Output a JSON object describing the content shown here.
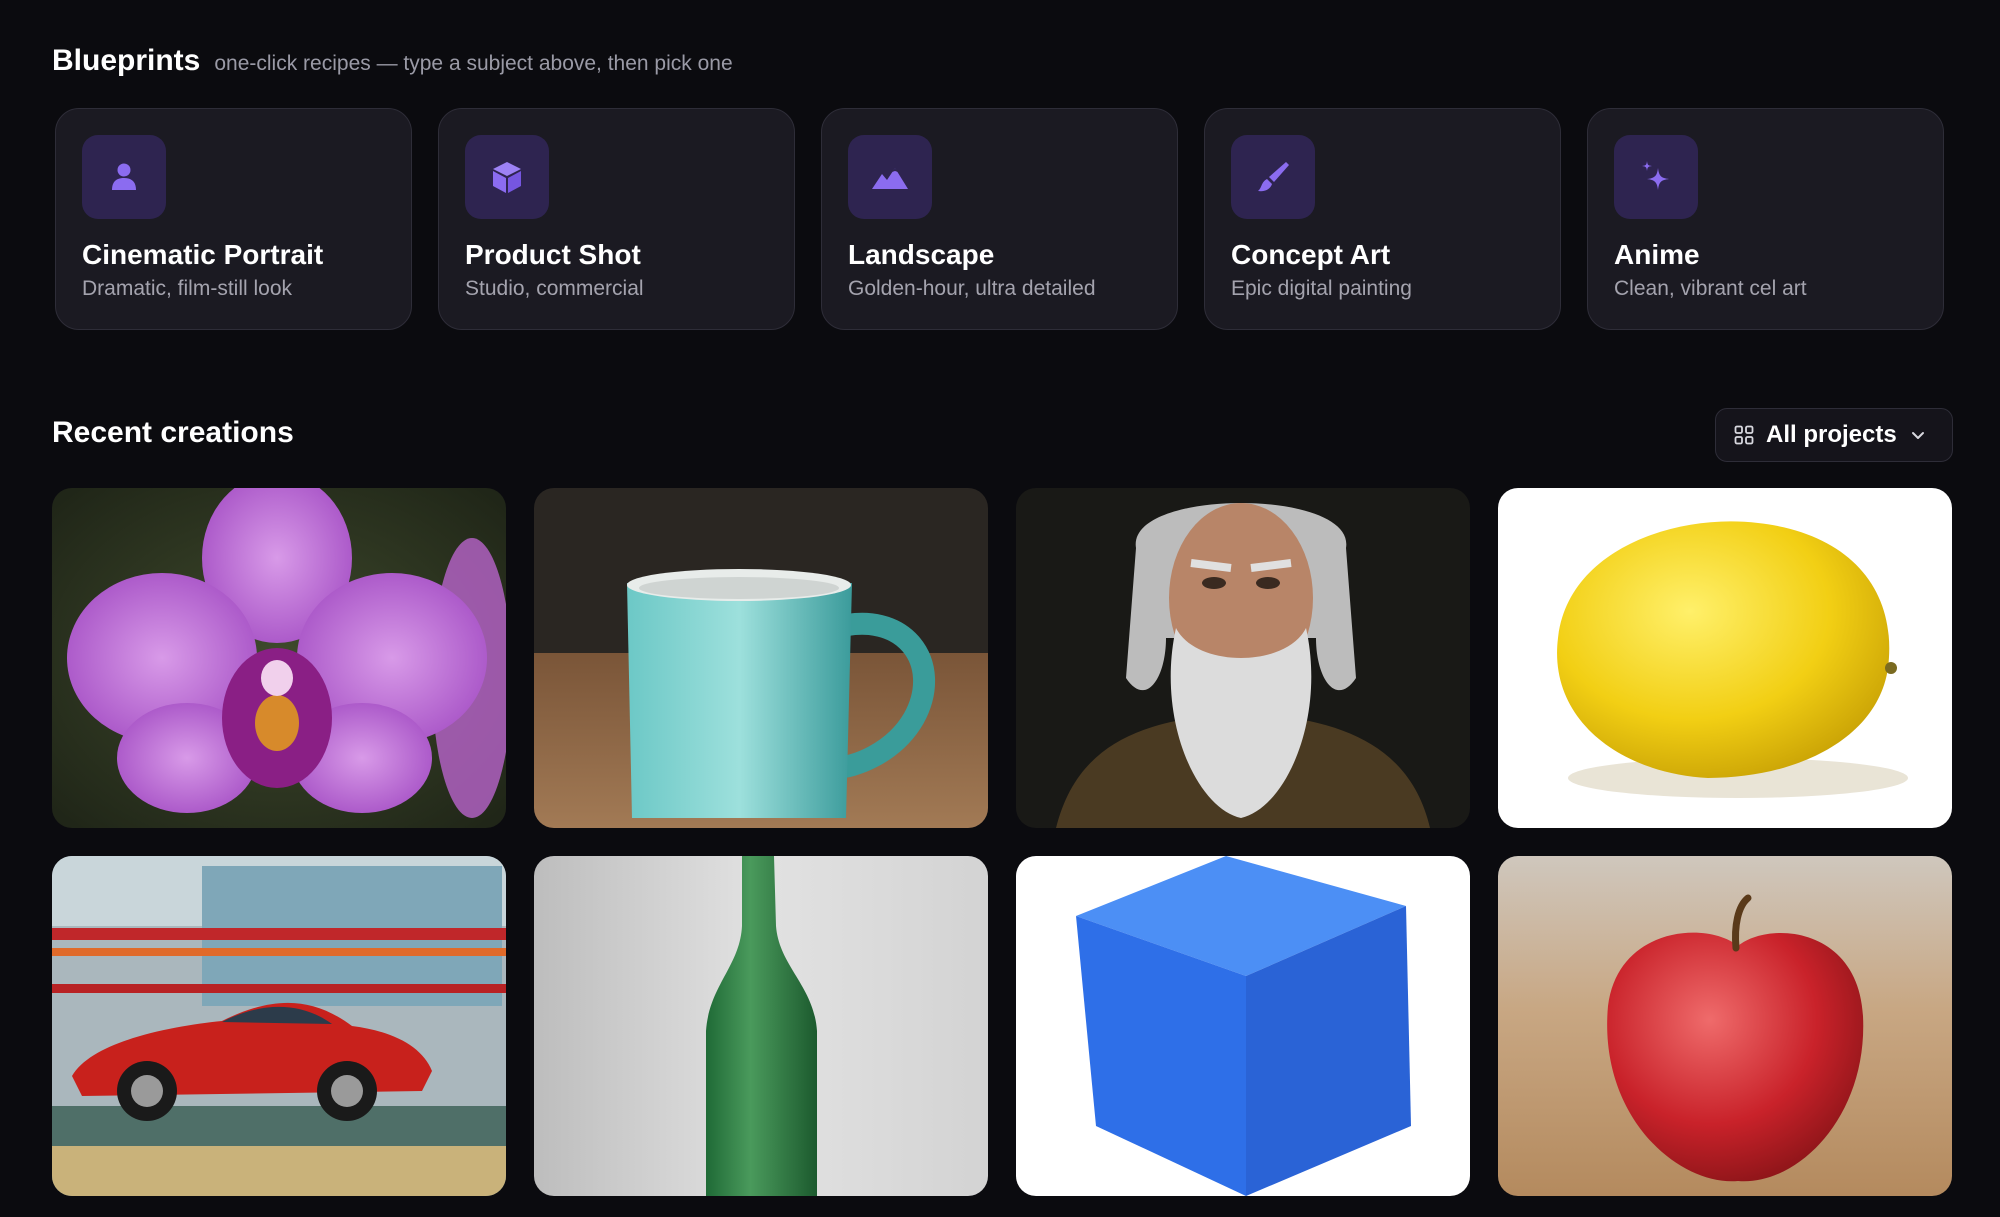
{
  "blueprints": {
    "title": "Blueprints",
    "subtitle": "one-click recipes — type a subject above, then pick one",
    "accent": "#8b6cf0",
    "icon_bg": "#2e2450",
    "items": [
      {
        "name": "Cinematic Portrait",
        "desc": "Dramatic, film-still look",
        "icon": "person-icon"
      },
      {
        "name": "Product Shot",
        "desc": "Studio, commercial",
        "icon": "box-icon"
      },
      {
        "name": "Landscape",
        "desc": "Golden-hour, ultra detailed",
        "icon": "mountains-icon"
      },
      {
        "name": "Concept Art",
        "desc": "Epic digital painting",
        "icon": "paintbrush-icon"
      },
      {
        "name": "Anime",
        "desc": "Clean, vibrant cel art",
        "icon": "sparkles-icon"
      }
    ]
  },
  "recent": {
    "title": "Recent creations",
    "filter_label": "All projects",
    "filter_icon": "grid-icon",
    "items": [
      {
        "subject": "orchid"
      },
      {
        "subject": "mug"
      },
      {
        "subject": "old-man"
      },
      {
        "subject": "lemon"
      },
      {
        "subject": "sports-car"
      },
      {
        "subject": "bottle"
      },
      {
        "subject": "cube"
      },
      {
        "subject": "apple"
      }
    ]
  }
}
